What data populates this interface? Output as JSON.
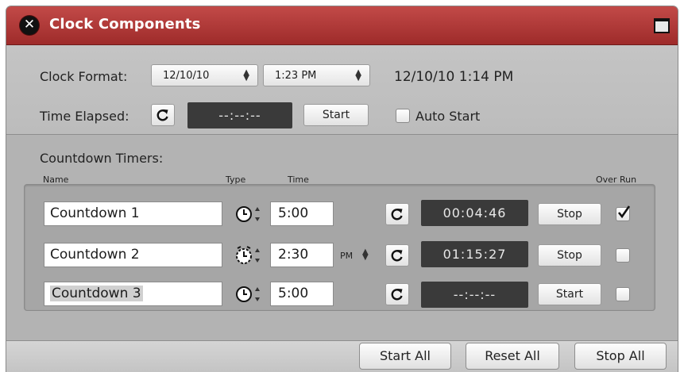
{
  "window": {
    "title": "Clock Components",
    "close_icon": "close-icon",
    "maximize_icon": "window-maximize-icon"
  },
  "clock": {
    "format_label": "Clock Format:",
    "date_value": "12/10/10",
    "time_value": "1:23 PM",
    "current_display": "12/10/10 1:14 PM",
    "elapsed_label": "Time Elapsed:",
    "elapsed_value": "--:--:--",
    "start_label": "Start",
    "auto_start_label": "Auto Start",
    "auto_start_checked": false
  },
  "countdown": {
    "section_label": "Countdown Timers:",
    "headers": {
      "name": "Name",
      "type": "Type",
      "time": "Time",
      "over_run": "Over Run"
    },
    "timers": [
      {
        "name": "Countdown 1",
        "type": "clock-icon",
        "time": "5:00",
        "ampm": "",
        "remaining": "00:04:46",
        "action": "Stop",
        "over_run": true
      },
      {
        "name": "Countdown 2",
        "type": "alarm-clock-icon",
        "time": "2:30",
        "ampm": "PM",
        "remaining": "01:15:27",
        "action": "Stop",
        "over_run": false
      },
      {
        "name": "Countdown 3",
        "type": "clock-icon",
        "time": "5:00",
        "ampm": "",
        "remaining": "--:--:--",
        "action": "Start",
        "over_run": false
      }
    ]
  },
  "footer": {
    "start_all": "Start All",
    "reset_all": "Reset All",
    "stop_all": "Stop All"
  },
  "colors": {
    "titlebar": "#b13a39",
    "dark_display": "#3a3a3a",
    "panel": "#b9b9b9"
  }
}
